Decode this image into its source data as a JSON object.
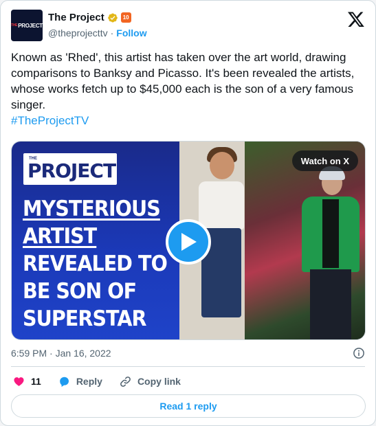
{
  "account": {
    "avatar_text_small": "THE",
    "avatar_text": "PROJECT",
    "name": "The Project",
    "badge_text": "10",
    "handle": "@theprojecttv",
    "separator": "·",
    "follow_label": "Follow"
  },
  "tweet": {
    "text": "Known as 'Rhed', this artist has taken over the art world, drawing comparisons to Banksy and Picasso. It's been revealed the artists, whose works fetch up to $45,000 each is the son of a very famous singer.",
    "hashtag": "#TheProjectTV"
  },
  "media": {
    "logo_small": "THE",
    "logo_word": "PROJECT",
    "headline_lines": [
      "MYSTERIOUS",
      "ARTIST",
      "REVEALED TO",
      "BE SON OF",
      "SUPERSTAR"
    ],
    "watch_label": "Watch on X"
  },
  "timestamp": "6:59 PM · Jan 16, 2022",
  "actions": {
    "like_count": "11",
    "reply_label": "Reply",
    "copy_label": "Copy link"
  },
  "read_reply_label": "Read 1 reply",
  "colors": {
    "accent": "#1d9bf0",
    "like": "#f91880",
    "badge": "#f26522",
    "verified": "#e2b719",
    "media_bg": "#1b39b8"
  },
  "icons": {
    "verified": "verified-badge-icon",
    "logo": "x-logo-icon",
    "play": "play-icon",
    "info": "info-icon",
    "like": "heart-icon",
    "reply": "speech-bubble-icon",
    "copy": "link-icon"
  }
}
